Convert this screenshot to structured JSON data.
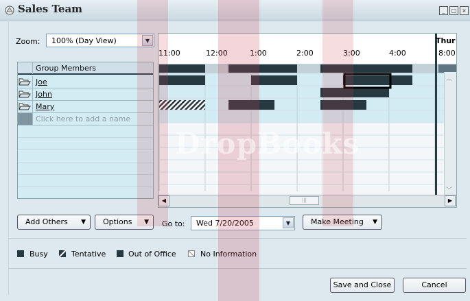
{
  "window": {
    "title": "Sales Team",
    "controls": [
      "minimize-icon",
      "restore-icon",
      "close-icon"
    ]
  },
  "zoom": {
    "label": "Zoom:",
    "value": "100% (Day View)"
  },
  "members": {
    "header": "Group Members",
    "rows": [
      {
        "name": "Joe",
        "icon": "folder-open-icon"
      },
      {
        "name": "John",
        "icon": "folder-open-icon"
      },
      {
        "name": "Mary",
        "icon": "folder-open-icon"
      }
    ],
    "add_placeholder": "Click here to add a name"
  },
  "timeline": {
    "day_label": "Thur",
    "times": [
      "11:00",
      "12:00",
      "1:00",
      "2:00",
      "3:00",
      "4:00",
      "8:00"
    ]
  },
  "buttons": {
    "add_others": "Add Others",
    "options": "Options",
    "make_meeting": "Make Meeting",
    "save_close": "Save and Close",
    "cancel": "Cancel"
  },
  "goto": {
    "label": "Go to:",
    "value": "Wed 7/20/2005"
  },
  "legend": [
    {
      "label": "Busy",
      "color": "#263840"
    },
    {
      "label": "Tentative",
      "color": "#263840"
    },
    {
      "label": "Out of Office",
      "color": "#263840"
    },
    {
      "label": "No Information",
      "color": "#ffffff"
    }
  ],
  "watermark": "DropBooks",
  "colors": {
    "busy": "#263840",
    "selection": "#000000",
    "grid_bg": "#f3f7fa",
    "row_bg": "#d3ecf4"
  }
}
